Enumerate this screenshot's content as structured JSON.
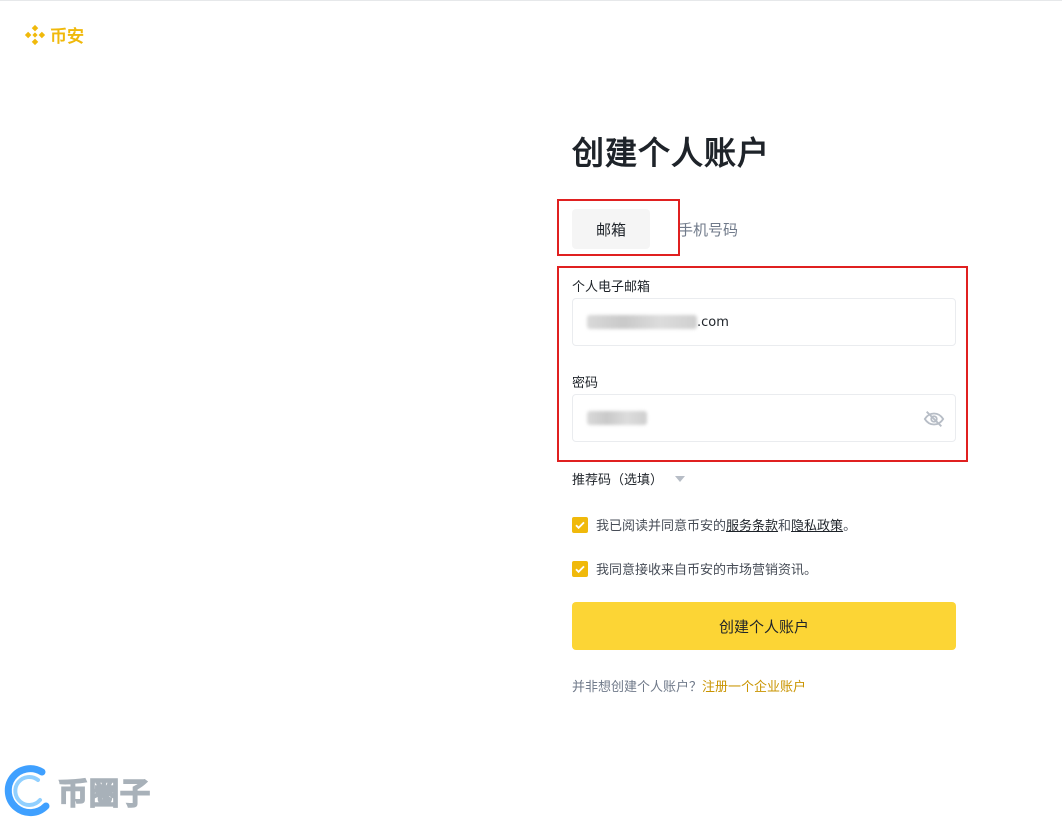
{
  "brand": {
    "name": "币安",
    "color": "#f0b90b"
  },
  "page": {
    "title": "创建个人账户"
  },
  "tabs": [
    {
      "label": "邮箱",
      "active": true
    },
    {
      "label": "手机号码",
      "active": false
    }
  ],
  "email_field": {
    "label": "个人电子邮箱",
    "value_visible_suffix": ".com"
  },
  "password_field": {
    "label": "密码",
    "visibility_icon": "eye-off-icon"
  },
  "referral": {
    "label": "推荐码（选填）"
  },
  "agreements": {
    "terms_prefix": "我已阅读并同意币安的",
    "terms_link": "服务条款",
    "terms_and": "和",
    "privacy_link": "隐私政策",
    "terms_suffix": "。",
    "terms_checked": true,
    "marketing_text": "我同意接收来自币安的市场营销资讯。",
    "marketing_checked": true
  },
  "submit_button": {
    "label": "创建个人账户",
    "color": "#fcd535"
  },
  "footer": {
    "question": "并非想创建个人账户？",
    "link": "注册一个企业账户"
  },
  "watermark": {
    "text": "币圈子"
  },
  "highlight_color": "#e02020"
}
